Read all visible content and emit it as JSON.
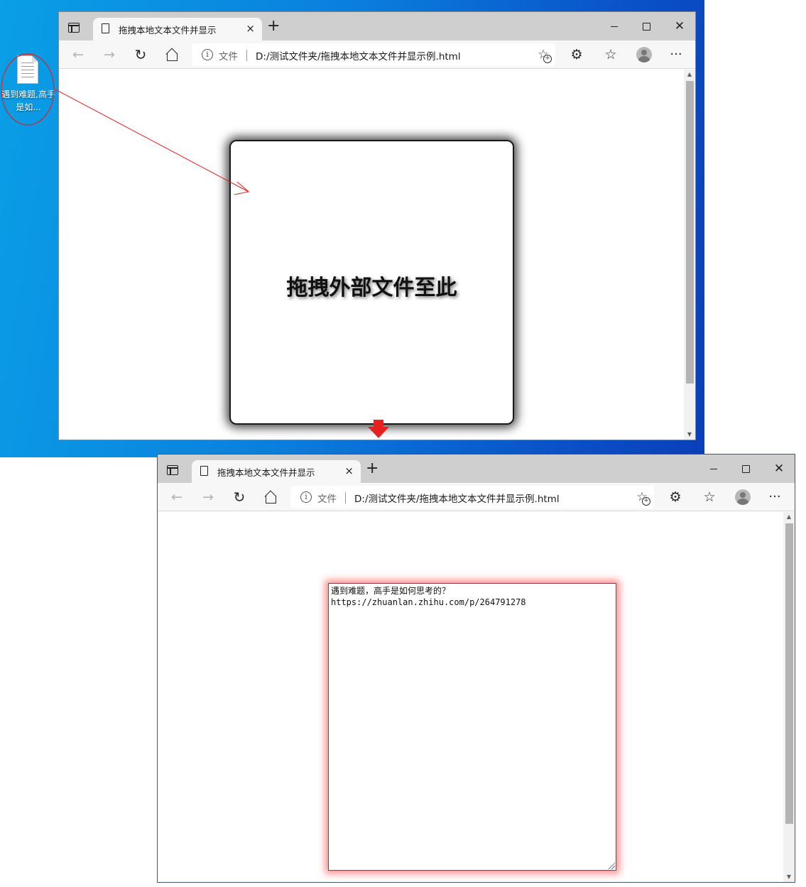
{
  "desktop": {
    "file_icon_label": "遇到难题,高手是如..."
  },
  "window_top": {
    "tab_title": "拖拽本地文本文件并显示",
    "address": {
      "site_label": "文件",
      "url": "D:/测试文件夹/拖拽本地文本文件并显示例.html"
    },
    "drop_zone_text": "拖拽外部文件至此"
  },
  "window_bottom": {
    "tab_title": "拖拽本地文本文件并显示",
    "address": {
      "site_label": "文件",
      "url": "D:/测试文件夹/拖拽本地文本文件并显示例.html"
    },
    "textarea_content": "遇到难题，高手是如何思考的？\nhttps://zhuanlan.zhihu.com/p/264791278"
  },
  "icons": {
    "tab_close": "×",
    "new_tab": "+",
    "close_window": "✕",
    "back": "←",
    "forward": "→",
    "refresh": "↻",
    "info": "i",
    "favorite_add": "☆",
    "extensions": "⚙",
    "favorites": "☆",
    "more": "···",
    "scroll_up": "▲",
    "scroll_down": "▼"
  },
  "colors": {
    "drag_annotation": "#e02020",
    "textarea_glow": "#ff4646",
    "flow_arrow": "#e5221f"
  }
}
